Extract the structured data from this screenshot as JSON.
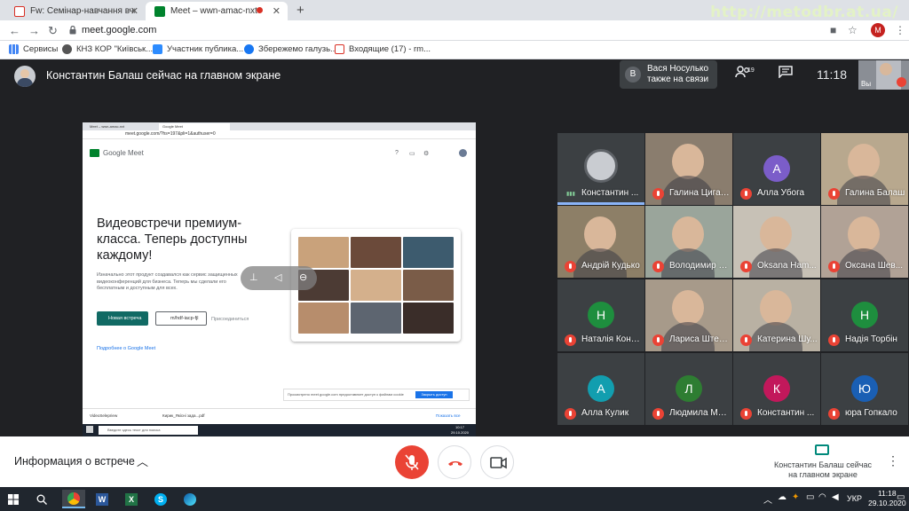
{
  "browser": {
    "tabs": [
      {
        "label": "Fw: Семінар-навчання вчителів",
        "icon_color": "#d93025",
        "active": false
      },
      {
        "label": "Meet – wwn-amac-nxt",
        "icon_color": "#00832d",
        "active": true
      },
      {
        "label": "",
        "icon_color": "#d93025",
        "active": false
      }
    ],
    "watermark": "http://metodbr.at.ua/",
    "url": "meet.google.com",
    "profile_initial": "M",
    "bookmarks": [
      {
        "label": "Сервисы",
        "icon": "apps-icon"
      },
      {
        "label": "КНЗ КОР \"Київськ...",
        "icon": "globe-icon"
      },
      {
        "label": "Участник публика...",
        "icon": "video-icon"
      },
      {
        "label": "Збережемо галузь...",
        "icon": "facebook-icon"
      },
      {
        "label": "Входящие (17) - rm...",
        "icon": "gmail-icon"
      }
    ]
  },
  "meet": {
    "presenter_title": "Константин Балаш сейчас на главном экране",
    "join_notice": {
      "initial": "В",
      "line1": "Вася Носулько",
      "line2": "также на связи"
    },
    "people_count": "19",
    "time": "11:18",
    "self_label": "Вы",
    "participants": [
      {
        "name": "Константин ...",
        "initial": "",
        "color": "#3c4043",
        "muted": false,
        "speaking": true,
        "photo": "avatar"
      },
      {
        "name": "Галина Циган...",
        "initial": "",
        "color": "#8a7d6e",
        "muted": true,
        "photo": "video"
      },
      {
        "name": "Алла Убога",
        "initial": "А",
        "color": "#7b5dc9",
        "muted": true
      },
      {
        "name": "Галина Балаш",
        "initial": "",
        "color": "#b8a88e",
        "muted": true,
        "photo": "video"
      },
      {
        "name": "Андрій Кудько",
        "initial": "",
        "color": "#8d7f67",
        "muted": true,
        "photo": "video"
      },
      {
        "name": "Володимир Л...",
        "initial": "",
        "color": "#9aa59b",
        "muted": true,
        "photo": "video"
      },
      {
        "name": "Oksana Ham...",
        "initial": "",
        "color": "#c7c1b6",
        "muted": true,
        "photo": "video"
      },
      {
        "name": "Оксана Шев...",
        "initial": "",
        "color": "#b1a296",
        "muted": true,
        "photo": "video"
      },
      {
        "name": "Наталія Коно...",
        "initial": "Н",
        "color": "#1e8e3e",
        "muted": true
      },
      {
        "name": "Лариса Штеф...",
        "initial": "",
        "color": "#a79a8a",
        "muted": true,
        "photo": "video"
      },
      {
        "name": "Катерина Шу...",
        "initial": "",
        "color": "#b9b1a3",
        "muted": true,
        "photo": "video"
      },
      {
        "name": "Надія Торбін",
        "initial": "Н",
        "color": "#1e8e3e",
        "muted": true
      },
      {
        "name": "Алла Кулик",
        "initial": "А",
        "color": "#129eaf",
        "muted": true
      },
      {
        "name": "Людмила Ма...",
        "initial": "Л",
        "color": "#2e7d32",
        "muted": true
      },
      {
        "name": "Константин ...",
        "initial": "К",
        "color": "#c2185b",
        "muted": true
      },
      {
        "name": "юра Гопкало",
        "initial": "Ю",
        "color": "#1a5fb4",
        "muted": true
      }
    ]
  },
  "presented": {
    "tabs": [
      "Meet – wwn-amac-nxt",
      "Google Meet"
    ],
    "url": "meet.google.com/?hs=197&pli=1&authuser=0",
    "logo_text": "Google Meet",
    "hero": "Видеовстречи премиум-класса. Теперь доступны каждому!",
    "desc": "Изначально этот продукт создавался как сервис защищенных видеоконференций для бизнеса. Теперь мы сделали его бесплатным и доступным для всех.",
    "new_meeting": "Новая встреча",
    "code_input": "m/hdf-iacp-fjl",
    "join": "Присоединиться",
    "more": "Подробнее о Google Meet",
    "cookie_text": "Просмотрено meet.google.com предоставляет доступ к файлам cookie",
    "cookie_btn": "Закрыть доступ",
    "downloads": [
      "VideoSelepriew",
      "Кирик_Якісні зада...pdf"
    ],
    "downloads_all": "Показать все",
    "search_placeholder": "Введите здесь текст для поиска",
    "clock": "10:17\n29.10.2020"
  },
  "controls": {
    "info_label": "Информация о встрече",
    "presenting_label": "Константин Балаш сейчас на главном экране"
  },
  "taskbar": {
    "lang": "УКР",
    "time": "11:18",
    "date": "29.10.2020"
  },
  "colors": {
    "meet_bg": "#202124",
    "mute_red": "#ea4335",
    "speaking_blue": "#8ab4f8"
  }
}
